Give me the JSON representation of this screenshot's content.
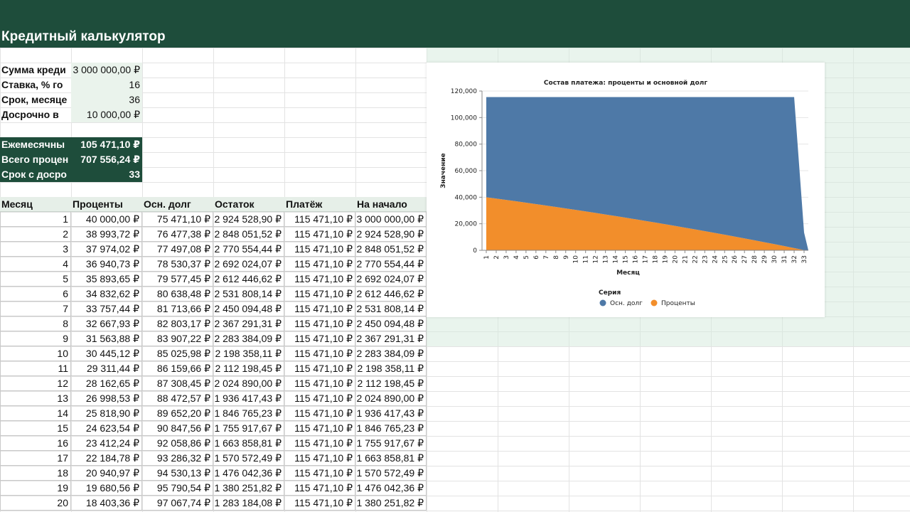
{
  "app": {
    "title": "Кредитный калькулятор"
  },
  "inputs": [
    {
      "label": "Сумма креди",
      "value": "3 000 000,00 ₽"
    },
    {
      "label": "Ставка, % го",
      "value": "16"
    },
    {
      "label": "Срок, месяце",
      "value": "36"
    },
    {
      "label": "Досрочно в",
      "value": "10 000,00 ₽"
    }
  ],
  "outputs": [
    {
      "label": "Ежемесячны",
      "value": "105 471,10 ₽"
    },
    {
      "label": "Всего процен",
      "value": "707 556,24 ₽"
    },
    {
      "label": "Срок с досро",
      "value": "33"
    }
  ],
  "table": {
    "headers": [
      "Месяц",
      "Проценты",
      "Осн. долг",
      "Остаток",
      "Платёж",
      "На начало"
    ],
    "rows": [
      [
        "1",
        "40 000,00 ₽",
        "75 471,10 ₽",
        "2 924 528,90 ₽",
        "115 471,10 ₽",
        "3 000 000,00 ₽"
      ],
      [
        "2",
        "38 993,72 ₽",
        "76 477,38 ₽",
        "2 848 051,52 ₽",
        "115 471,10 ₽",
        "2 924 528,90 ₽"
      ],
      [
        "3",
        "37 974,02 ₽",
        "77 497,08 ₽",
        "2 770 554,44 ₽",
        "115 471,10 ₽",
        "2 848 051,52 ₽"
      ],
      [
        "4",
        "36 940,73 ₽",
        "78 530,37 ₽",
        "2 692 024,07 ₽",
        "115 471,10 ₽",
        "2 770 554,44 ₽"
      ],
      [
        "5",
        "35 893,65 ₽",
        "79 577,45 ₽",
        "2 612 446,62 ₽",
        "115 471,10 ₽",
        "2 692 024,07 ₽"
      ],
      [
        "6",
        "34 832,62 ₽",
        "80 638,48 ₽",
        "2 531 808,14 ₽",
        "115 471,10 ₽",
        "2 612 446,62 ₽"
      ],
      [
        "7",
        "33 757,44 ₽",
        "81 713,66 ₽",
        "2 450 094,48 ₽",
        "115 471,10 ₽",
        "2 531 808,14 ₽"
      ],
      [
        "8",
        "32 667,93 ₽",
        "82 803,17 ₽",
        "2 367 291,31 ₽",
        "115 471,10 ₽",
        "2 450 094,48 ₽"
      ],
      [
        "9",
        "31 563,88 ₽",
        "83 907,22 ₽",
        "2 283 384,09 ₽",
        "115 471,10 ₽",
        "2 367 291,31 ₽"
      ],
      [
        "10",
        "30 445,12 ₽",
        "85 025,98 ₽",
        "2 198 358,11 ₽",
        "115 471,10 ₽",
        "2 283 384,09 ₽"
      ],
      [
        "11",
        "29 311,44 ₽",
        "86 159,66 ₽",
        "2 112 198,45 ₽",
        "115 471,10 ₽",
        "2 198 358,11 ₽"
      ],
      [
        "12",
        "28 162,65 ₽",
        "87 308,45 ₽",
        "2 024 890,00 ₽",
        "115 471,10 ₽",
        "2 112 198,45 ₽"
      ],
      [
        "13",
        "26 998,53 ₽",
        "88 472,57 ₽",
        "1 936 417,43 ₽",
        "115 471,10 ₽",
        "2 024 890,00 ₽"
      ],
      [
        "14",
        "25 818,90 ₽",
        "89 652,20 ₽",
        "1 846 765,23 ₽",
        "115 471,10 ₽",
        "1 936 417,43 ₽"
      ],
      [
        "15",
        "24 623,54 ₽",
        "90 847,56 ₽",
        "1 755 917,67 ₽",
        "115 471,10 ₽",
        "1 846 765,23 ₽"
      ],
      [
        "16",
        "23 412,24 ₽",
        "92 058,86 ₽",
        "1 663 858,81 ₽",
        "115 471,10 ₽",
        "1 755 917,67 ₽"
      ],
      [
        "17",
        "22 184,78 ₽",
        "93 286,32 ₽",
        "1 570 572,49 ₽",
        "115 471,10 ₽",
        "1 663 858,81 ₽"
      ],
      [
        "18",
        "20 940,97 ₽",
        "94 530,13 ₽",
        "1 476 042,36 ₽",
        "115 471,10 ₽",
        "1 570 572,49 ₽"
      ],
      [
        "19",
        "19 680,56 ₽",
        "95 790,54 ₽",
        "1 380 251,82 ₽",
        "115 471,10 ₽",
        "1 476 042,36 ₽"
      ],
      [
        "20",
        "18 403,36 ₽",
        "97 067,74 ₽",
        "1 283 184,08 ₽",
        "115 471,10 ₽",
        "1 380 251,82 ₽"
      ]
    ]
  },
  "chart_data": {
    "type": "area",
    "title": "Состав платежа: проценты и основной долг",
    "xlabel": "Месяц",
    "ylabel": "Значение",
    "ylim": [
      0,
      120000
    ],
    "yticks": [
      "0",
      "20,000",
      "40,000",
      "60,000",
      "80,000",
      "100,000",
      "120,000"
    ],
    "x": [
      "1",
      "2",
      "3",
      "4",
      "5",
      "6",
      "7",
      "8",
      "9",
      "10",
      "11",
      "12",
      "13",
      "14",
      "15",
      "16",
      "17",
      "18",
      "19",
      "20",
      "21",
      "22",
      "23",
      "24",
      "25",
      "26",
      "27",
      "28",
      "29",
      "30",
      "31",
      "32",
      "33"
    ],
    "stacked": true,
    "legend_title": "Серия",
    "legend_position": "bottom",
    "series": [
      {
        "name": "Проценты",
        "color": "#f28e2b",
        "values": [
          40000,
          38994,
          37974,
          36941,
          35894,
          34833,
          33757,
          32668,
          31564,
          30445,
          29311,
          28163,
          26999,
          25819,
          24624,
          23412,
          22185,
          20941,
          19681,
          18403,
          17109,
          15798,
          14469,
          13123,
          11759,
          10377,
          8977,
          7558,
          6121,
          4664,
          3188,
          1693,
          178
        ]
      },
      {
        "name": "Осн. долг",
        "color": "#4e79a7",
        "values": [
          75471,
          76477,
          77497,
          78530,
          79577,
          80638,
          81714,
          82803,
          83907,
          85026,
          86160,
          87308,
          88473,
          89652,
          90848,
          92059,
          93286,
          94530,
          95791,
          97068,
          98362,
          99673,
          101002,
          102348,
          103712,
          105094,
          106494,
          107913,
          109350,
          110807,
          112283,
          113778,
          13182
        ]
      }
    ],
    "legend": [
      "Осн. долг",
      "Проценты"
    ]
  }
}
